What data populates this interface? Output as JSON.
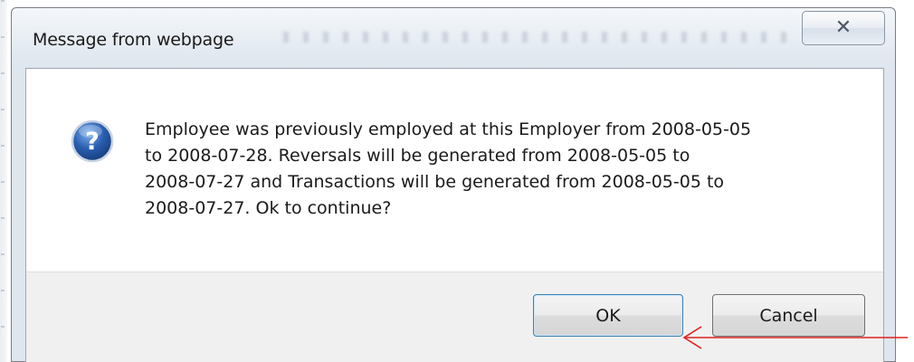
{
  "dialog": {
    "title": "Message from webpage",
    "close_icon": "close-icon",
    "message_lines": [
      "Employee was previously employed at this Employer from 2008-05-05",
      "to 2008-07-28. Reversals will be generated from 2008-05-05 to",
      "2008-07-27 and Transactions will be generated from 2008-05-05 to",
      "2008-07-27. Ok to continue?"
    ],
    "icon": "question-icon",
    "ok_label": "OK",
    "cancel_label": "Cancel",
    "default_button": "OK"
  },
  "annotation": {
    "icon": "red-arrow-icon",
    "color": "#e02020"
  },
  "colors": {
    "question_icon_blue": "#2a5fb0",
    "default_button_border": "#3c7fb1"
  }
}
